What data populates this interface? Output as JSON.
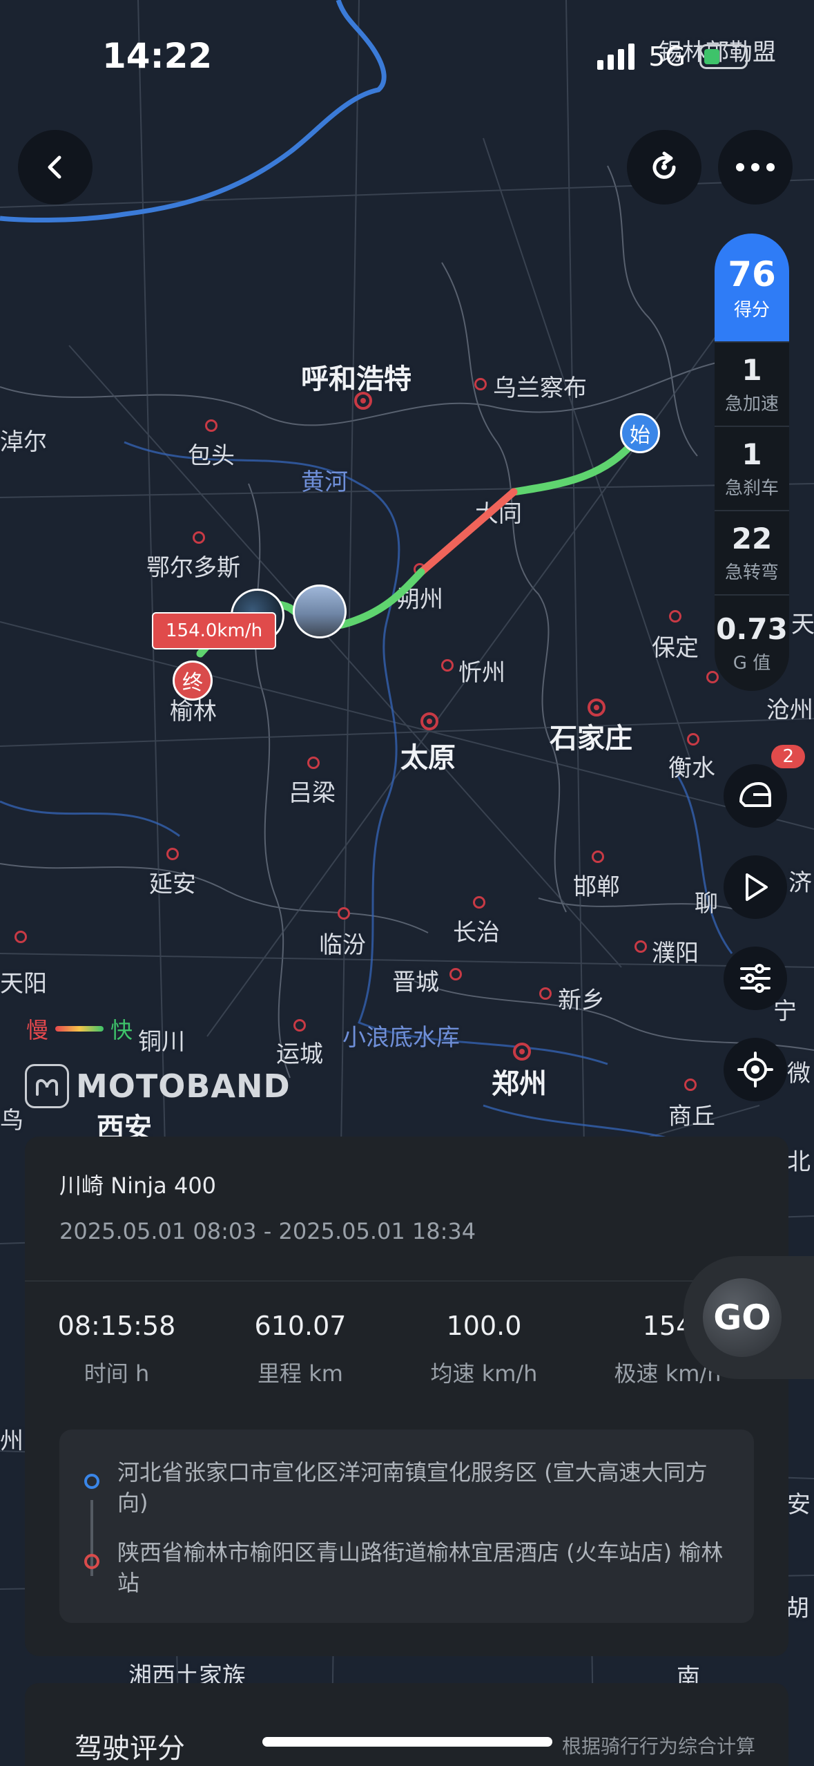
{
  "status_bar": {
    "time": "14:22",
    "network": "5G"
  },
  "map_labels": {
    "xilinguole": "锡林郭勒盟",
    "huhehaote": "呼和浩特",
    "wulanchabu": "乌兰察布",
    "zhuoer": "淖尔",
    "baotou": "包头",
    "huanghe": "黄河",
    "datong": "大同",
    "eerduosi": "鄂尔多斯",
    "shuozhou": "朔州",
    "baoding": "保定",
    "tian": "天",
    "yulin": "榆林",
    "xinzhou": "忻州",
    "cangzhou": "沧州",
    "taiyuan": "太原",
    "shijiazhuang": "石家庄",
    "hengshui": "衡水",
    "lvliang": "吕梁",
    "yanan": "延安",
    "handan": "邯郸",
    "liao": "聊",
    "ji": "济",
    "linfen": "临汾",
    "changzhi": "长治",
    "puyang": "濮阳",
    "jincheng": "晋城",
    "tianyang": "天阳",
    "xinxiang": "新乡",
    "tongchuan": "铜川",
    "yuncheng": "运城",
    "xiaolangdi": "小浪底水库",
    "zhengzhou": "郑州",
    "xian": "西安",
    "shangqiu": "商丘",
    "bei": "北",
    "zhou": "州",
    "an": "安",
    "hu": "胡",
    "xiangxi": "湘西土家族",
    "nan": "南",
    "niao": "鸟",
    "ning": "宁",
    "wei": "微"
  },
  "route": {
    "start_label": "始",
    "end_label": "终",
    "max_speed_tag": "154.0km/h"
  },
  "score_panel": {
    "score": "76",
    "score_label": "得分",
    "stats": [
      {
        "value": "1",
        "label": "急加速"
      },
      {
        "value": "1",
        "label": "急刹车"
      },
      {
        "value": "22",
        "label": "急转弯"
      },
      {
        "value": "0.73",
        "label": "G 值"
      }
    ]
  },
  "helmet_badge": "2",
  "legend": {
    "slow": "慢",
    "fast": "快"
  },
  "brand": "MOTOBAND",
  "trip_card": {
    "vehicle": "川崎 Ninja 400",
    "time_range": "2025.05.01 08:03 - 2025.05.01 18:34",
    "metrics": [
      {
        "value": "08:15:58",
        "label": "时间 h"
      },
      {
        "value": "610.07",
        "label": "里程 km"
      },
      {
        "value": "100.0",
        "label": "均速 km/h"
      },
      {
        "value": "154",
        "label": "极速 km/h"
      }
    ],
    "start_address": "河北省张家口市宣化区洋河南镇宣化服务区 (宣大高速大同方向)",
    "end_address": "陕西省榆林市榆阳区青山路街道榆林宜居酒店 (火车站店) 榆林站"
  },
  "go_button": "GO",
  "rating_card": {
    "title": "驾驶评分",
    "note": "根据骑行行为综合计算"
  },
  "colors": {
    "accent_blue": "#2f7cf6",
    "route_green": "#5fd46f",
    "route_red": "#f0645a",
    "start_blue": "#3a86e8",
    "end_red": "#d94b4b"
  }
}
